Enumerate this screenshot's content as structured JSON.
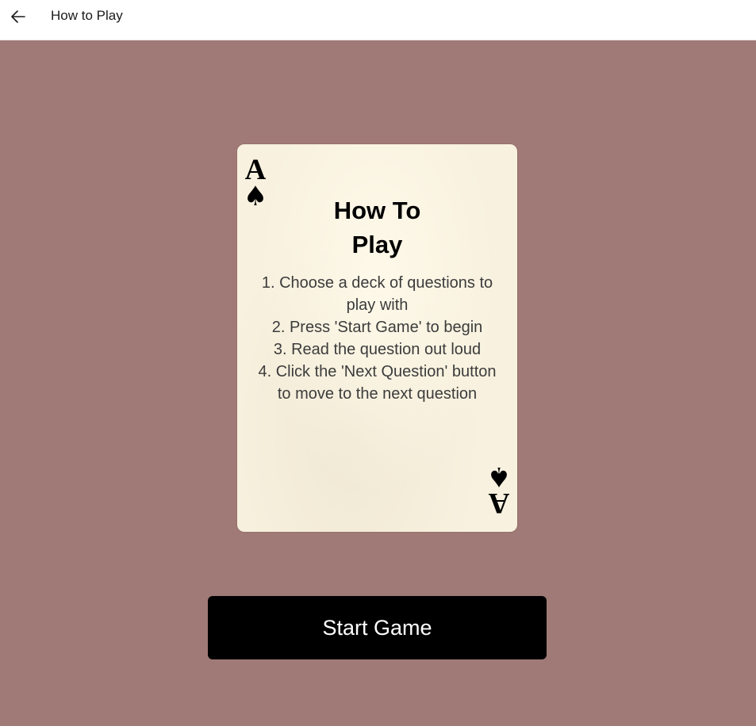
{
  "window": {
    "title": "How to Play",
    "back_icon": "arrow-left-icon"
  },
  "colors": {
    "background": "#a07a76",
    "card": "#f8f1df",
    "button": "#000000",
    "button_text": "#ffffff"
  },
  "card": {
    "rank": "A",
    "suit_icon": "spade-icon",
    "suit_glyph": "♠",
    "title_lines": [
      "How To",
      "Play"
    ],
    "steps": [
      "1. Choose a deck of questions to",
      "play with",
      "2. Press 'Start Game' to begin",
      "3. Read the question out loud",
      "4. Click the 'Next Question' button",
      "to move to the next question"
    ]
  },
  "actions": {
    "start_label": "Start Game"
  }
}
